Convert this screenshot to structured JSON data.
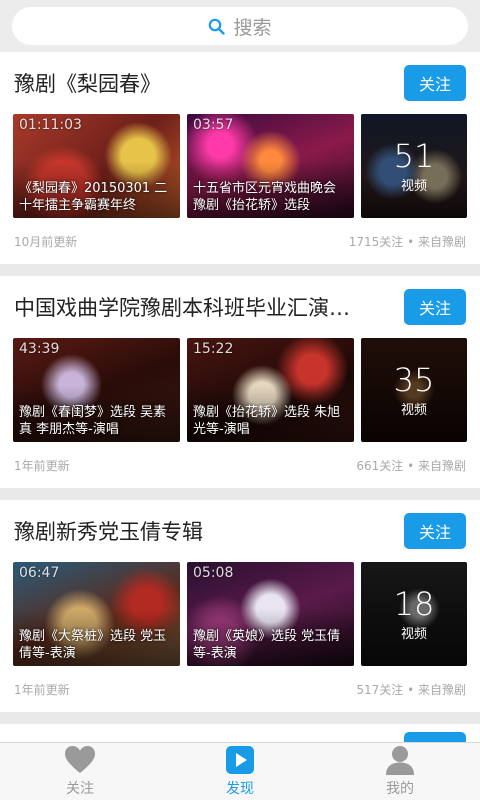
{
  "search": {
    "placeholder": "搜索",
    "icon": "search-icon"
  },
  "cards": [
    {
      "title": "豫剧《梨园春》",
      "follow_label": "关注",
      "videos": [
        {
          "duration": "01:11:03",
          "caption": "《梨园春》20150301 二十年擂主争霸赛年终"
        },
        {
          "duration": "03:57",
          "caption": "十五省市区元宵戏曲晚会 豫剧《抬花轿》选段"
        }
      ],
      "more": {
        "count": "51",
        "unit": "视频"
      },
      "updated": "10月前更新",
      "meta": "1715关注 • 来自豫剧"
    },
    {
      "title": "中国戏曲学院豫剧本科班毕业汇演…",
      "follow_label": "关注",
      "videos": [
        {
          "duration": "43:39",
          "caption": "豫剧《春闺梦》选段 吴素真 李朋杰等-演唱"
        },
        {
          "duration": "15:22",
          "caption": "豫剧《抬花轿》选段 朱旭光等-演唱"
        }
      ],
      "more": {
        "count": "35",
        "unit": "视频"
      },
      "updated": "1年前更新",
      "meta": "661关注 • 来自豫剧"
    },
    {
      "title": "豫剧新秀党玉倩专辑",
      "follow_label": "关注",
      "videos": [
        {
          "duration": "06:47",
          "caption": "豫剧《大祭桩》选段 党玉倩等-表演"
        },
        {
          "duration": "05:08",
          "caption": "豫剧《英娘》选段 党玉倩等-表演"
        }
      ],
      "more": {
        "count": "18",
        "unit": "视频"
      },
      "updated": "1年前更新",
      "meta": "517关注 • 来自豫剧"
    }
  ],
  "tabs": [
    {
      "label": "关注",
      "icon": "heart-icon",
      "active": false
    },
    {
      "label": "发现",
      "icon": "play-icon",
      "active": true
    },
    {
      "label": "我的",
      "icon": "user-icon",
      "active": false
    }
  ],
  "colors": {
    "accent": "#1a9be8",
    "muted": "#9a9a9a",
    "background": "#e9e9e9"
  }
}
